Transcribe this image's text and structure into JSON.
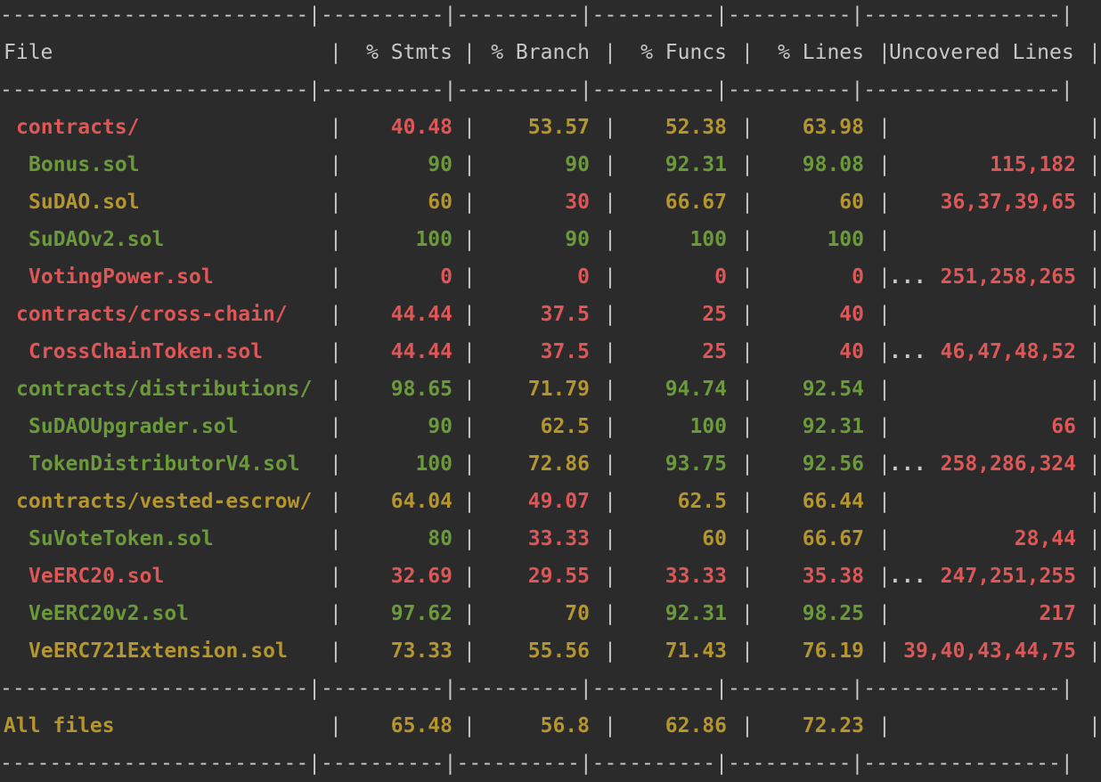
{
  "colors": {
    "background": "#2b2b2b",
    "text": "#c8c8c8",
    "green": "#6a9a3a",
    "yellow": "#b5952e",
    "red": "#df5656"
  },
  "table": {
    "separator_row": "-------------------------|----------|----------|----------|----------|----------------|",
    "headers": [
      "File",
      "% Stmts",
      "% Branch",
      "% Funcs",
      "% Lines",
      "Uncovered Lines"
    ],
    "rows": [
      {
        "file": "contracts/",
        "indent": 1,
        "file_color": "red",
        "stmts": "40.48",
        "stmts_color": "red",
        "branch": "53.57",
        "branch_color": "yellow",
        "funcs": "52.38",
        "funcs_color": "yellow",
        "lines": "63.98",
        "lines_color": "yellow",
        "uncovered": "",
        "uncovered_prefix": ""
      },
      {
        "file": "Bonus.sol",
        "indent": 2,
        "file_color": "green",
        "stmts": "90",
        "stmts_color": "green",
        "branch": "90",
        "branch_color": "green",
        "funcs": "92.31",
        "funcs_color": "green",
        "lines": "98.08",
        "lines_color": "green",
        "uncovered": "115,182",
        "uncovered_prefix": ""
      },
      {
        "file": "SuDAO.sol",
        "indent": 2,
        "file_color": "yellow",
        "stmts": "60",
        "stmts_color": "yellow",
        "branch": "30",
        "branch_color": "red",
        "funcs": "66.67",
        "funcs_color": "yellow",
        "lines": "60",
        "lines_color": "yellow",
        "uncovered": "36,37,39,65",
        "uncovered_prefix": ""
      },
      {
        "file": "SuDAOv2.sol",
        "indent": 2,
        "file_color": "green",
        "stmts": "100",
        "stmts_color": "green",
        "branch": "90",
        "branch_color": "green",
        "funcs": "100",
        "funcs_color": "green",
        "lines": "100",
        "lines_color": "green",
        "uncovered": "",
        "uncovered_prefix": ""
      },
      {
        "file": "VotingPower.sol",
        "indent": 2,
        "file_color": "red",
        "stmts": "0",
        "stmts_color": "red",
        "branch": "0",
        "branch_color": "red",
        "funcs": "0",
        "funcs_color": "red",
        "lines": "0",
        "lines_color": "red",
        "uncovered": "251,258,265",
        "uncovered_prefix": "..."
      },
      {
        "file": "contracts/cross-chain/",
        "indent": 1,
        "file_color": "red",
        "stmts": "44.44",
        "stmts_color": "red",
        "branch": "37.5",
        "branch_color": "red",
        "funcs": "25",
        "funcs_color": "red",
        "lines": "40",
        "lines_color": "red",
        "uncovered": "",
        "uncovered_prefix": ""
      },
      {
        "file": "CrossChainToken.sol",
        "indent": 2,
        "file_color": "red",
        "stmts": "44.44",
        "stmts_color": "red",
        "branch": "37.5",
        "branch_color": "red",
        "funcs": "25",
        "funcs_color": "red",
        "lines": "40",
        "lines_color": "red",
        "uncovered": "46,47,48,52",
        "uncovered_prefix": "..."
      },
      {
        "file": "contracts/distributions/",
        "indent": 1,
        "file_color": "green",
        "stmts": "98.65",
        "stmts_color": "green",
        "branch": "71.79",
        "branch_color": "yellow",
        "funcs": "94.74",
        "funcs_color": "green",
        "lines": "92.54",
        "lines_color": "green",
        "uncovered": "",
        "uncovered_prefix": ""
      },
      {
        "file": "SuDAOUpgrader.sol",
        "indent": 2,
        "file_color": "green",
        "stmts": "90",
        "stmts_color": "green",
        "branch": "62.5",
        "branch_color": "yellow",
        "funcs": "100",
        "funcs_color": "green",
        "lines": "92.31",
        "lines_color": "green",
        "uncovered": "66",
        "uncovered_prefix": ""
      },
      {
        "file": "TokenDistributorV4.sol",
        "indent": 2,
        "file_color": "green",
        "stmts": "100",
        "stmts_color": "green",
        "branch": "72.86",
        "branch_color": "yellow",
        "funcs": "93.75",
        "funcs_color": "green",
        "lines": "92.56",
        "lines_color": "green",
        "uncovered": "258,286,324",
        "uncovered_prefix": "..."
      },
      {
        "file": "contracts/vested-escrow/",
        "indent": 1,
        "file_color": "yellow",
        "stmts": "64.04",
        "stmts_color": "yellow",
        "branch": "49.07",
        "branch_color": "red",
        "funcs": "62.5",
        "funcs_color": "yellow",
        "lines": "66.44",
        "lines_color": "yellow",
        "uncovered": "",
        "uncovered_prefix": ""
      },
      {
        "file": "SuVoteToken.sol",
        "indent": 2,
        "file_color": "green",
        "stmts": "80",
        "stmts_color": "green",
        "branch": "33.33",
        "branch_color": "red",
        "funcs": "60",
        "funcs_color": "yellow",
        "lines": "66.67",
        "lines_color": "yellow",
        "uncovered": "28,44",
        "uncovered_prefix": ""
      },
      {
        "file": "VeERC20.sol",
        "indent": 2,
        "file_color": "red",
        "stmts": "32.69",
        "stmts_color": "red",
        "branch": "29.55",
        "branch_color": "red",
        "funcs": "33.33",
        "funcs_color": "red",
        "lines": "35.38",
        "lines_color": "red",
        "uncovered": "247,251,255",
        "uncovered_prefix": "..."
      },
      {
        "file": "VeERC20v2.sol",
        "indent": 2,
        "file_color": "green",
        "stmts": "97.62",
        "stmts_color": "green",
        "branch": "70",
        "branch_color": "yellow",
        "funcs": "92.31",
        "funcs_color": "green",
        "lines": "98.25",
        "lines_color": "green",
        "uncovered": "217",
        "uncovered_prefix": ""
      },
      {
        "file": "VeERC721Extension.sol",
        "indent": 2,
        "file_color": "yellow",
        "stmts": "73.33",
        "stmts_color": "yellow",
        "branch": "55.56",
        "branch_color": "yellow",
        "funcs": "71.43",
        "funcs_color": "yellow",
        "lines": "76.19",
        "lines_color": "yellow",
        "uncovered": "39,40,43,44,75",
        "uncovered_prefix": ""
      }
    ],
    "total": {
      "file": "All files",
      "file_color": "yellow",
      "stmts": "65.48",
      "stmts_color": "yellow",
      "branch": "56.8",
      "branch_color": "yellow",
      "funcs": "62.86",
      "funcs_color": "yellow",
      "lines": "72.23",
      "lines_color": "yellow",
      "uncovered": ""
    }
  }
}
